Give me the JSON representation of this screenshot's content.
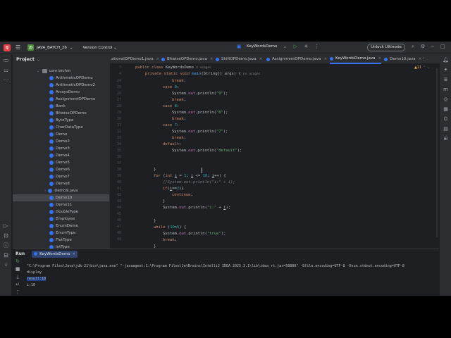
{
  "titlebar": {
    "project_badge": "JB",
    "project_name": "JAVA_BATCH_26",
    "version_control": "Version Control",
    "run_config": "KeyWordsDemo",
    "unlock_button": "Unlock Ultimate"
  },
  "project_panel": {
    "title": "Project",
    "package": "com.techm",
    "items": [
      "ArithmeticOPDemo",
      "ArithmeticOPDemo2",
      "ArraysDemo",
      "AssignmentOPDemo",
      "Bank",
      "BitwiseOPDemo",
      "ByteType",
      "CharDataType",
      "Demo",
      "Demo2",
      "Demo3",
      "Demo4",
      "Demo5",
      "Demo6",
      "Demo7",
      "Demo8",
      "Demo9.java",
      "Demo10",
      "Demo11",
      "DoubleType",
      "Employee",
      "EnumDemo",
      "EnumType",
      "FlotType",
      "IntType"
    ],
    "selected_item": "Demo10"
  },
  "editor": {
    "tabs": [
      "ationalOPDemo1.java",
      "BitwiseOPDemo.java",
      "ShiftOPDemo.java",
      "AssignmentOPDemo.java",
      "KeyWordsDemo.java",
      "Demo10.java"
    ],
    "active_tab": "KeyWordsDemo.java",
    "problems_count": "11",
    "line_numbers": [
      "3",
      "4",
      "24",
      "25",
      "26",
      "27",
      "28",
      "29",
      "30",
      "31",
      "32",
      "33",
      "34",
      "35",
      "36",
      "37",
      "38",
      "39",
      "40",
      "41",
      "42",
      "43",
      "44",
      "45",
      "46",
      "47",
      "48",
      "49"
    ],
    "class_usages": "4 usages",
    "main_usages": "no usages"
  },
  "run_panel": {
    "title": "Run",
    "tab": "KeyWordsDemo",
    "output": [
      "\"C:\\Program Files\\Java\\jdk-21\\bin\\java.exe\" \"-javaagent:C:\\Program Files\\JetBrains\\IntelliJ IDEA 2025.3.1\\lib\\idea_rt.jar=58880\" -Dfile.encoding=UTF-8 -Dsun.stdout.encoding=UTF-8",
      "display",
      "result:10",
      "i:10"
    ]
  }
}
